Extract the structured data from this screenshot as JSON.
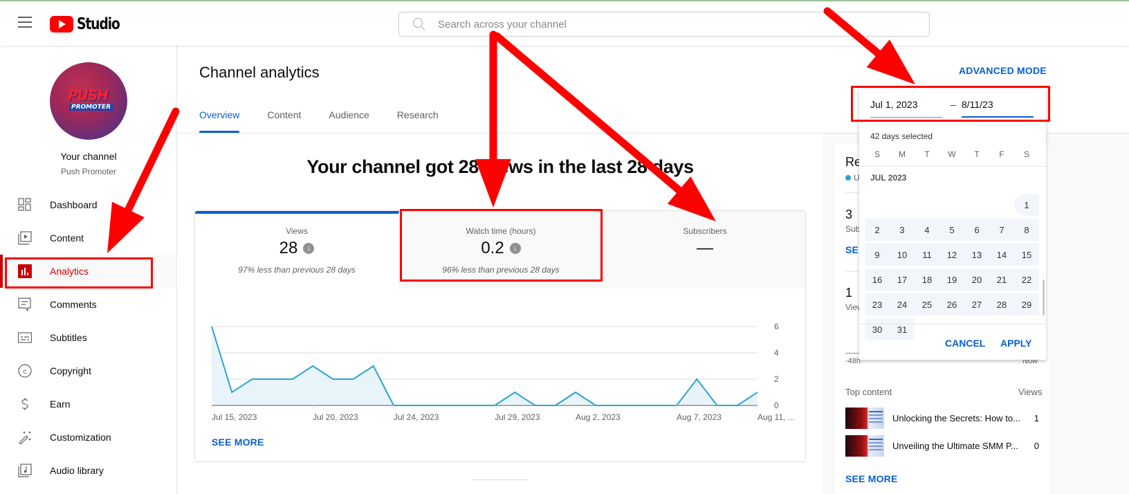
{
  "header": {
    "app_name": "Studio",
    "search_placeholder": "Search across your channel"
  },
  "sidebar": {
    "channel_title": "Your channel",
    "channel_name": "Push Promoter",
    "avatar_text_1": "PUSH",
    "avatar_text_2": "PROMOTER",
    "items": [
      {
        "label": "Dashboard",
        "icon": "dashboard-icon"
      },
      {
        "label": "Content",
        "icon": "content-icon"
      },
      {
        "label": "Analytics",
        "icon": "analytics-icon",
        "active": true
      },
      {
        "label": "Comments",
        "icon": "comments-icon"
      },
      {
        "label": "Subtitles",
        "icon": "subtitles-icon"
      },
      {
        "label": "Copyright",
        "icon": "copyright-icon"
      },
      {
        "label": "Earn",
        "icon": "earn-icon"
      },
      {
        "label": "Customization",
        "icon": "customization-icon"
      },
      {
        "label": "Audio library",
        "icon": "audio-library-icon"
      }
    ]
  },
  "main": {
    "title": "Channel analytics",
    "advanced_mode": "ADVANCED MODE",
    "tabs": [
      {
        "label": "Overview",
        "active": true
      },
      {
        "label": "Content"
      },
      {
        "label": "Audience"
      },
      {
        "label": "Research"
      }
    ],
    "headline": "Your channel got 28 views in the last 28 days",
    "metrics": [
      {
        "label": "Views",
        "value": "28",
        "trend": "down",
        "sub": "97% less than previous 28 days",
        "active": true
      },
      {
        "label": "Watch time (hours)",
        "value": "0.2",
        "trend": "down",
        "sub": "96% less than previous 28 days"
      },
      {
        "label": "Subscribers",
        "value": "—",
        "sub": ""
      }
    ],
    "see_more": "SEE MORE"
  },
  "chart_data": {
    "type": "area",
    "title": "Views",
    "xlabel": "",
    "ylabel": "",
    "x": [
      "Jul 15",
      "Jul 16",
      "Jul 17",
      "Jul 18",
      "Jul 19",
      "Jul 20",
      "Jul 21",
      "Jul 22",
      "Jul 23",
      "Jul 24",
      "Jul 25",
      "Jul 26",
      "Jul 27",
      "Jul 28",
      "Jul 29",
      "Jul 30",
      "Jul 31",
      "Aug 1",
      "Aug 2",
      "Aug 3",
      "Aug 4",
      "Aug 5",
      "Aug 6",
      "Aug 7",
      "Aug 8",
      "Aug 9",
      "Aug 10",
      "Aug 11"
    ],
    "values": [
      6,
      1,
      2,
      2,
      2,
      3,
      2,
      2,
      3,
      0,
      0,
      0,
      0,
      0,
      0,
      1,
      0,
      0,
      1,
      0,
      0,
      0,
      0,
      0,
      2,
      0,
      0,
      1
    ],
    "x_ticks": [
      {
        "index": 0,
        "label": "Jul 15, 2023"
      },
      {
        "index": 5,
        "label": "Jul 20, 2023"
      },
      {
        "index": 9,
        "label": "Jul 24, 2023"
      },
      {
        "index": 14,
        "label": "Jul 29, 2023"
      },
      {
        "index": 18,
        "label": "Aug 2, 2023"
      },
      {
        "index": 23,
        "label": "Aug 7, 2023"
      },
      {
        "index": 27,
        "label": "Aug 11, ..."
      }
    ],
    "y_ticks": [
      0,
      2,
      4,
      6
    ],
    "ylim": [
      0,
      6
    ],
    "grid": true,
    "color": "#2ba5d0"
  },
  "realtime": {
    "title": "Re",
    "live_label": "U",
    "subscribers_value": "3",
    "subscribers_label": "Sub",
    "see_more": "SEE",
    "views_value": "1",
    "views_label": "View",
    "axis_start": "-48h",
    "axis_end": "Now",
    "top_content_label": "Top content",
    "views_header": "Views",
    "top_content": [
      {
        "title": "Unlocking the Secrets: How to...",
        "views": "1"
      },
      {
        "title": "Unveiling the Ultimate SMM P...",
        "views": "0"
      }
    ],
    "see_more_full": "SEE MORE"
  },
  "date_picker": {
    "start": "Jul 1, 2023",
    "separator": "–",
    "end": "8/11/23",
    "days_selected": "42 days selected",
    "weekdays": [
      "S",
      "M",
      "T",
      "W",
      "T",
      "F",
      "S"
    ],
    "month_label": "JUL 2023",
    "first_weekday_offset": 6,
    "days_in_month": 31,
    "cancel": "CANCEL",
    "apply": "APPLY"
  },
  "annotations": {
    "arrow_color": "#ff0000"
  }
}
